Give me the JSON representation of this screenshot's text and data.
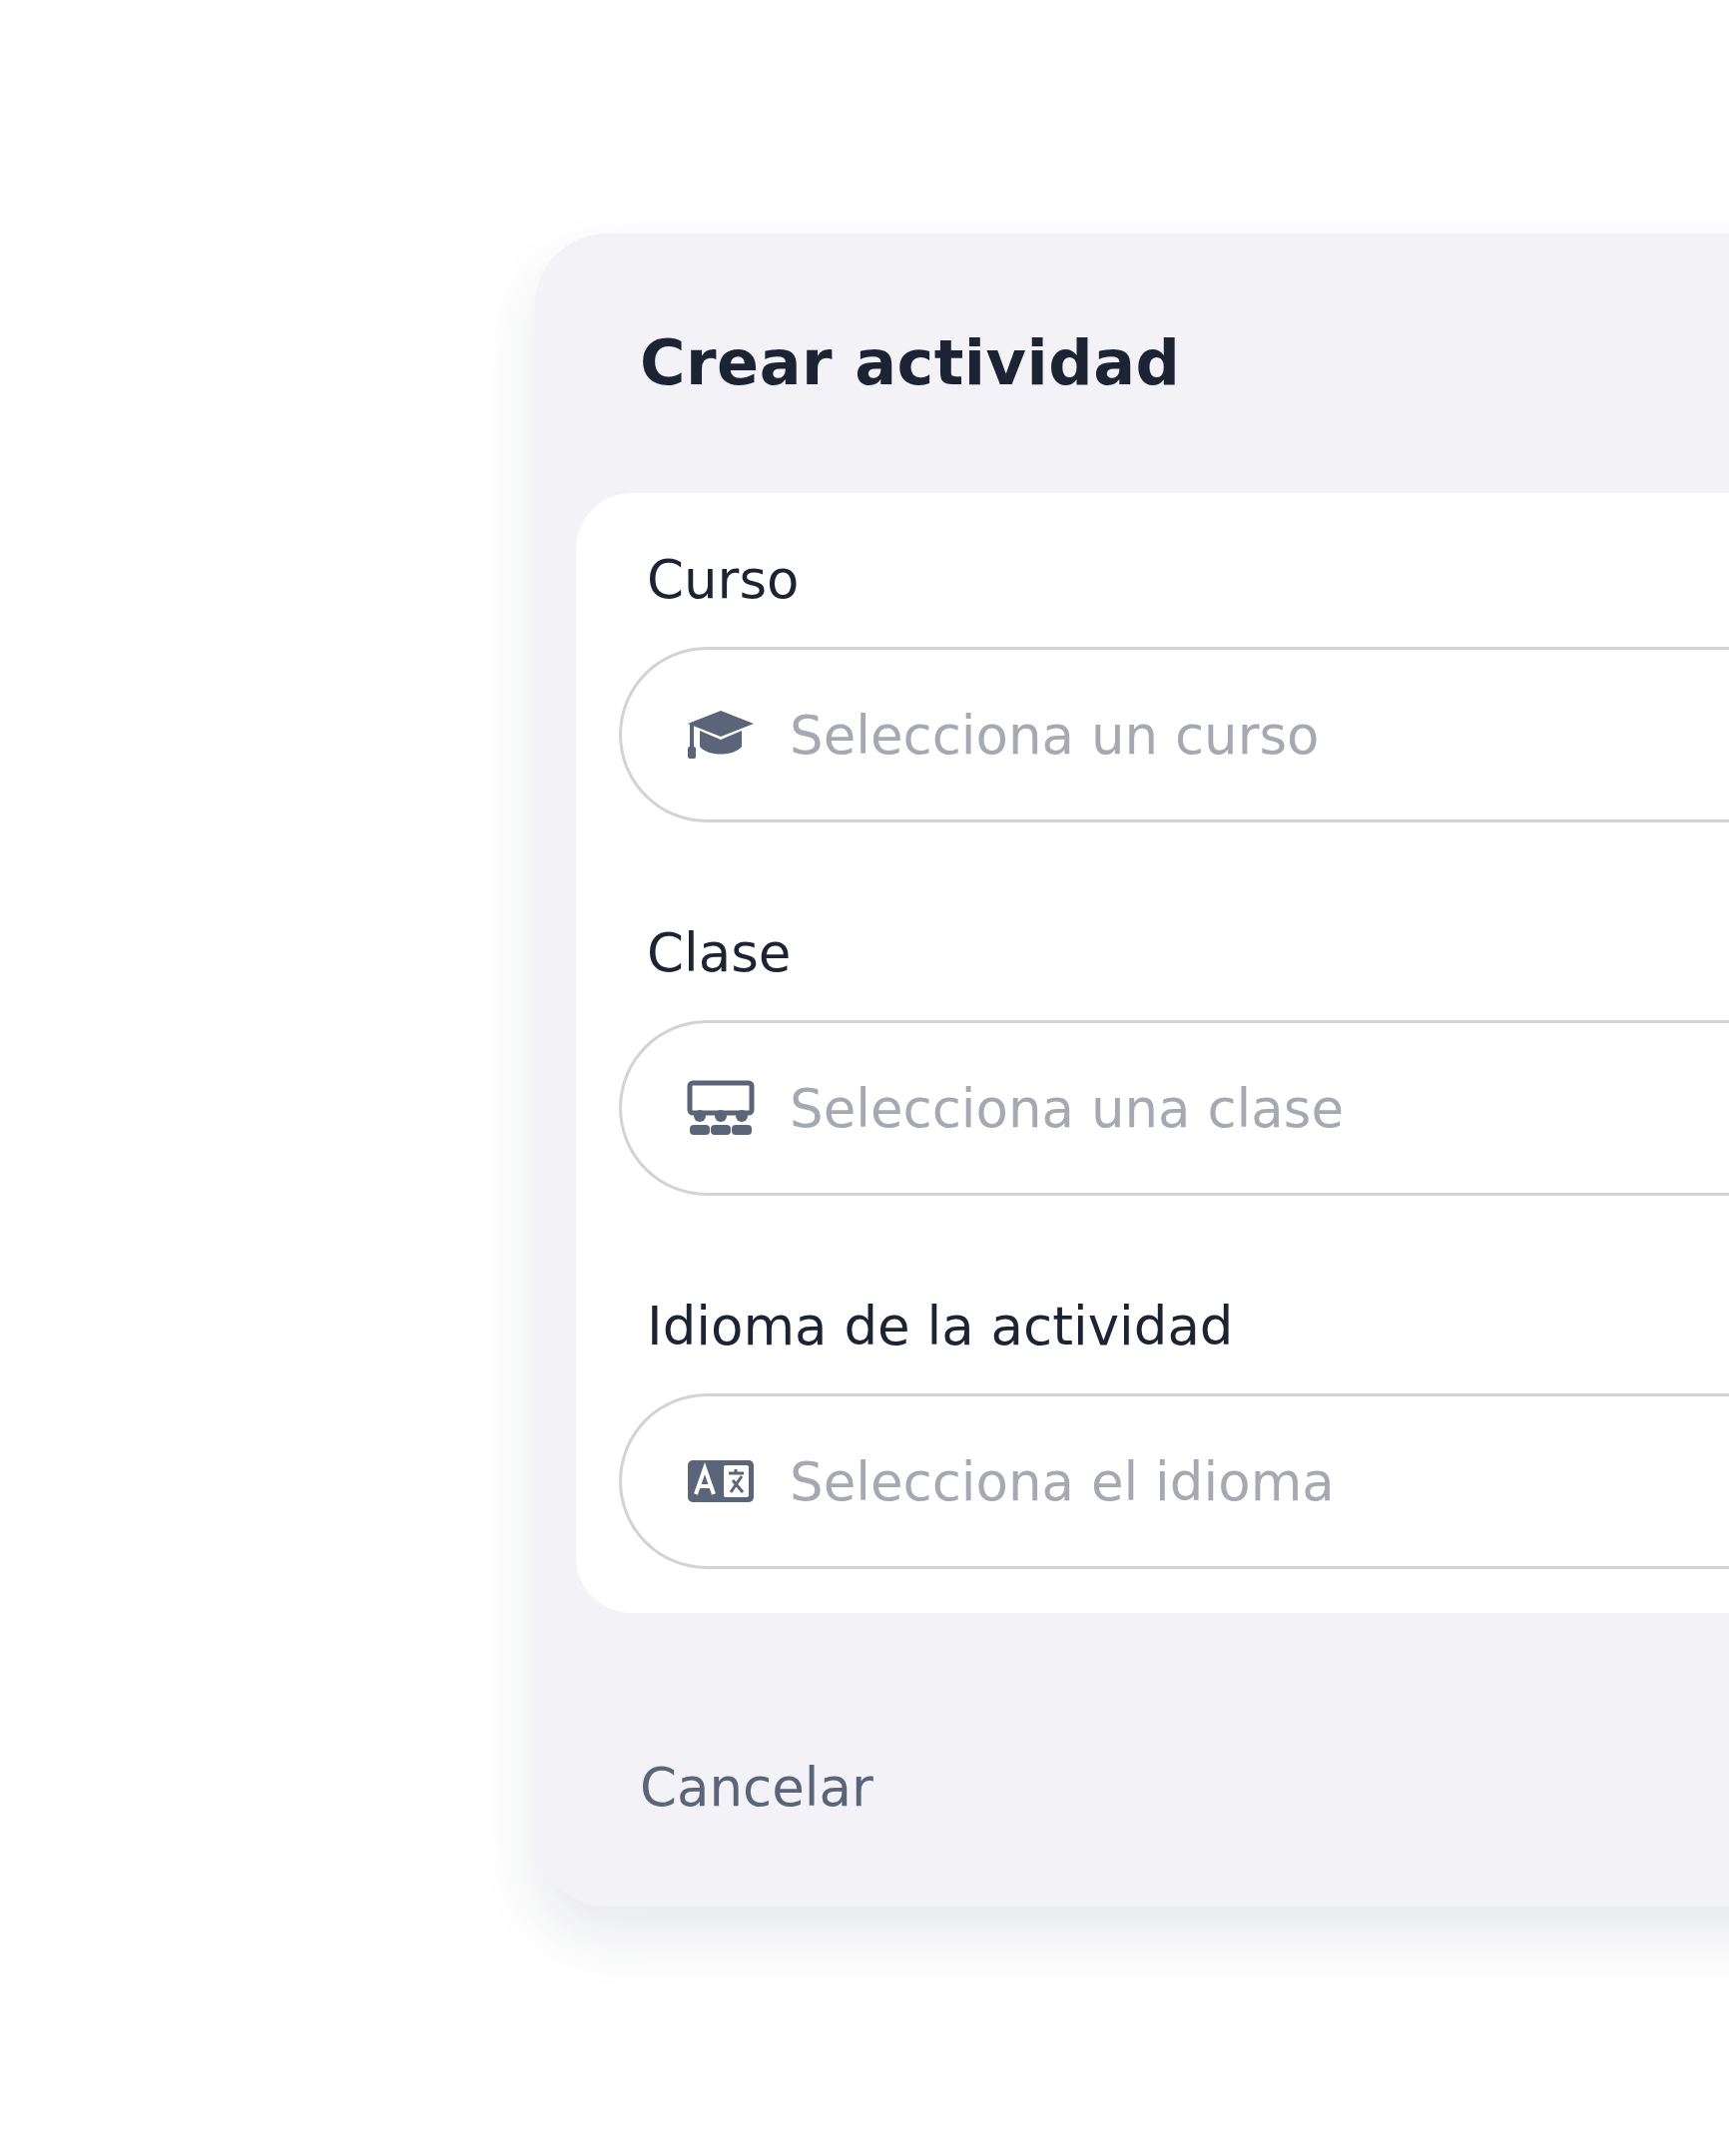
{
  "dialog": {
    "title": "Crear actividad",
    "fields": [
      {
        "label": "Curso",
        "placeholder": "Selecciona un curso",
        "kind": "course"
      },
      {
        "label": "Clase",
        "placeholder": "Selecciona una clase",
        "kind": "class"
      },
      {
        "label": "Idioma de la actividad",
        "placeholder": "Selecciona el idioma",
        "kind": "language"
      }
    ],
    "cancel": "Cancelar"
  }
}
